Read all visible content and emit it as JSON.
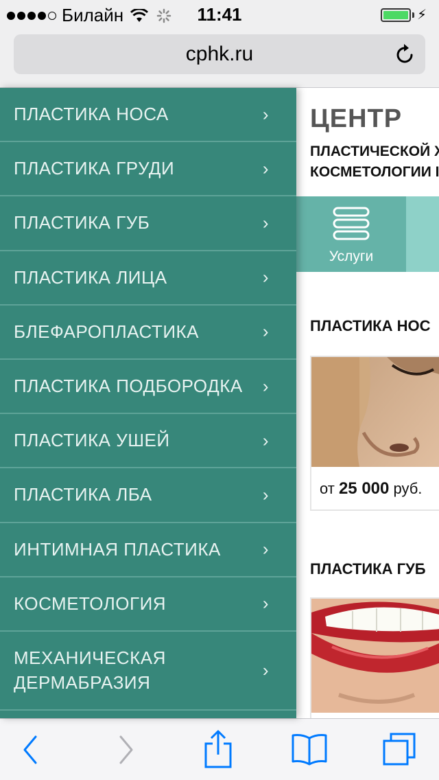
{
  "status_bar": {
    "carrier": "Билайн",
    "time": "11:41",
    "battery_color": "#4cd964"
  },
  "browser": {
    "url": "cphk.ru",
    "reload_icon": "reload-icon"
  },
  "menu": {
    "background": "#37877a",
    "items": [
      {
        "label": "ПЛАСТИКА НОСА"
      },
      {
        "label": "ПЛАСТИКА ГРУДИ"
      },
      {
        "label": "ПЛАСТИКА ГУБ"
      },
      {
        "label": "ПЛАСТИКА ЛИЦА"
      },
      {
        "label": "БЛЕФАРОПЛАСТИКА"
      },
      {
        "label": "ПЛАСТИКА ПОДБОРОДКА"
      },
      {
        "label": "ПЛАСТИКА УШЕЙ"
      },
      {
        "label": "ПЛАСТИКА ЛБА"
      },
      {
        "label": "ИНТИМНАЯ ПЛАСТИКА"
      },
      {
        "label": "КОСМЕТОЛОГИЯ"
      },
      {
        "label": "МЕХАНИЧЕСКАЯ\nДЕРМАБРАЗИЯ"
      }
    ],
    "chevron": "›"
  },
  "site": {
    "title": "ЦЕНТР",
    "subtitle_line1": "ПЛАСТИЧЕСКОЙ Х",
    "subtitle_line2": "КОСМЕТОЛОГИИ I",
    "nav_label": "Услуги",
    "nav_icon": "menu-icon"
  },
  "sections": [
    {
      "title": "ПЛАСТИКА НОС",
      "price_prefix": "от ",
      "price_value": "25 000",
      "price_suffix": " руб."
    },
    {
      "title": "ПЛАСТИКА ГУБ"
    }
  ],
  "toolbar": {
    "back_icon": "back-icon",
    "forward_icon": "forward-icon",
    "share_icon": "share-icon",
    "bookmarks_icon": "bookmarks-icon",
    "tabs_icon": "tabs-icon",
    "accent": "#007aff"
  }
}
